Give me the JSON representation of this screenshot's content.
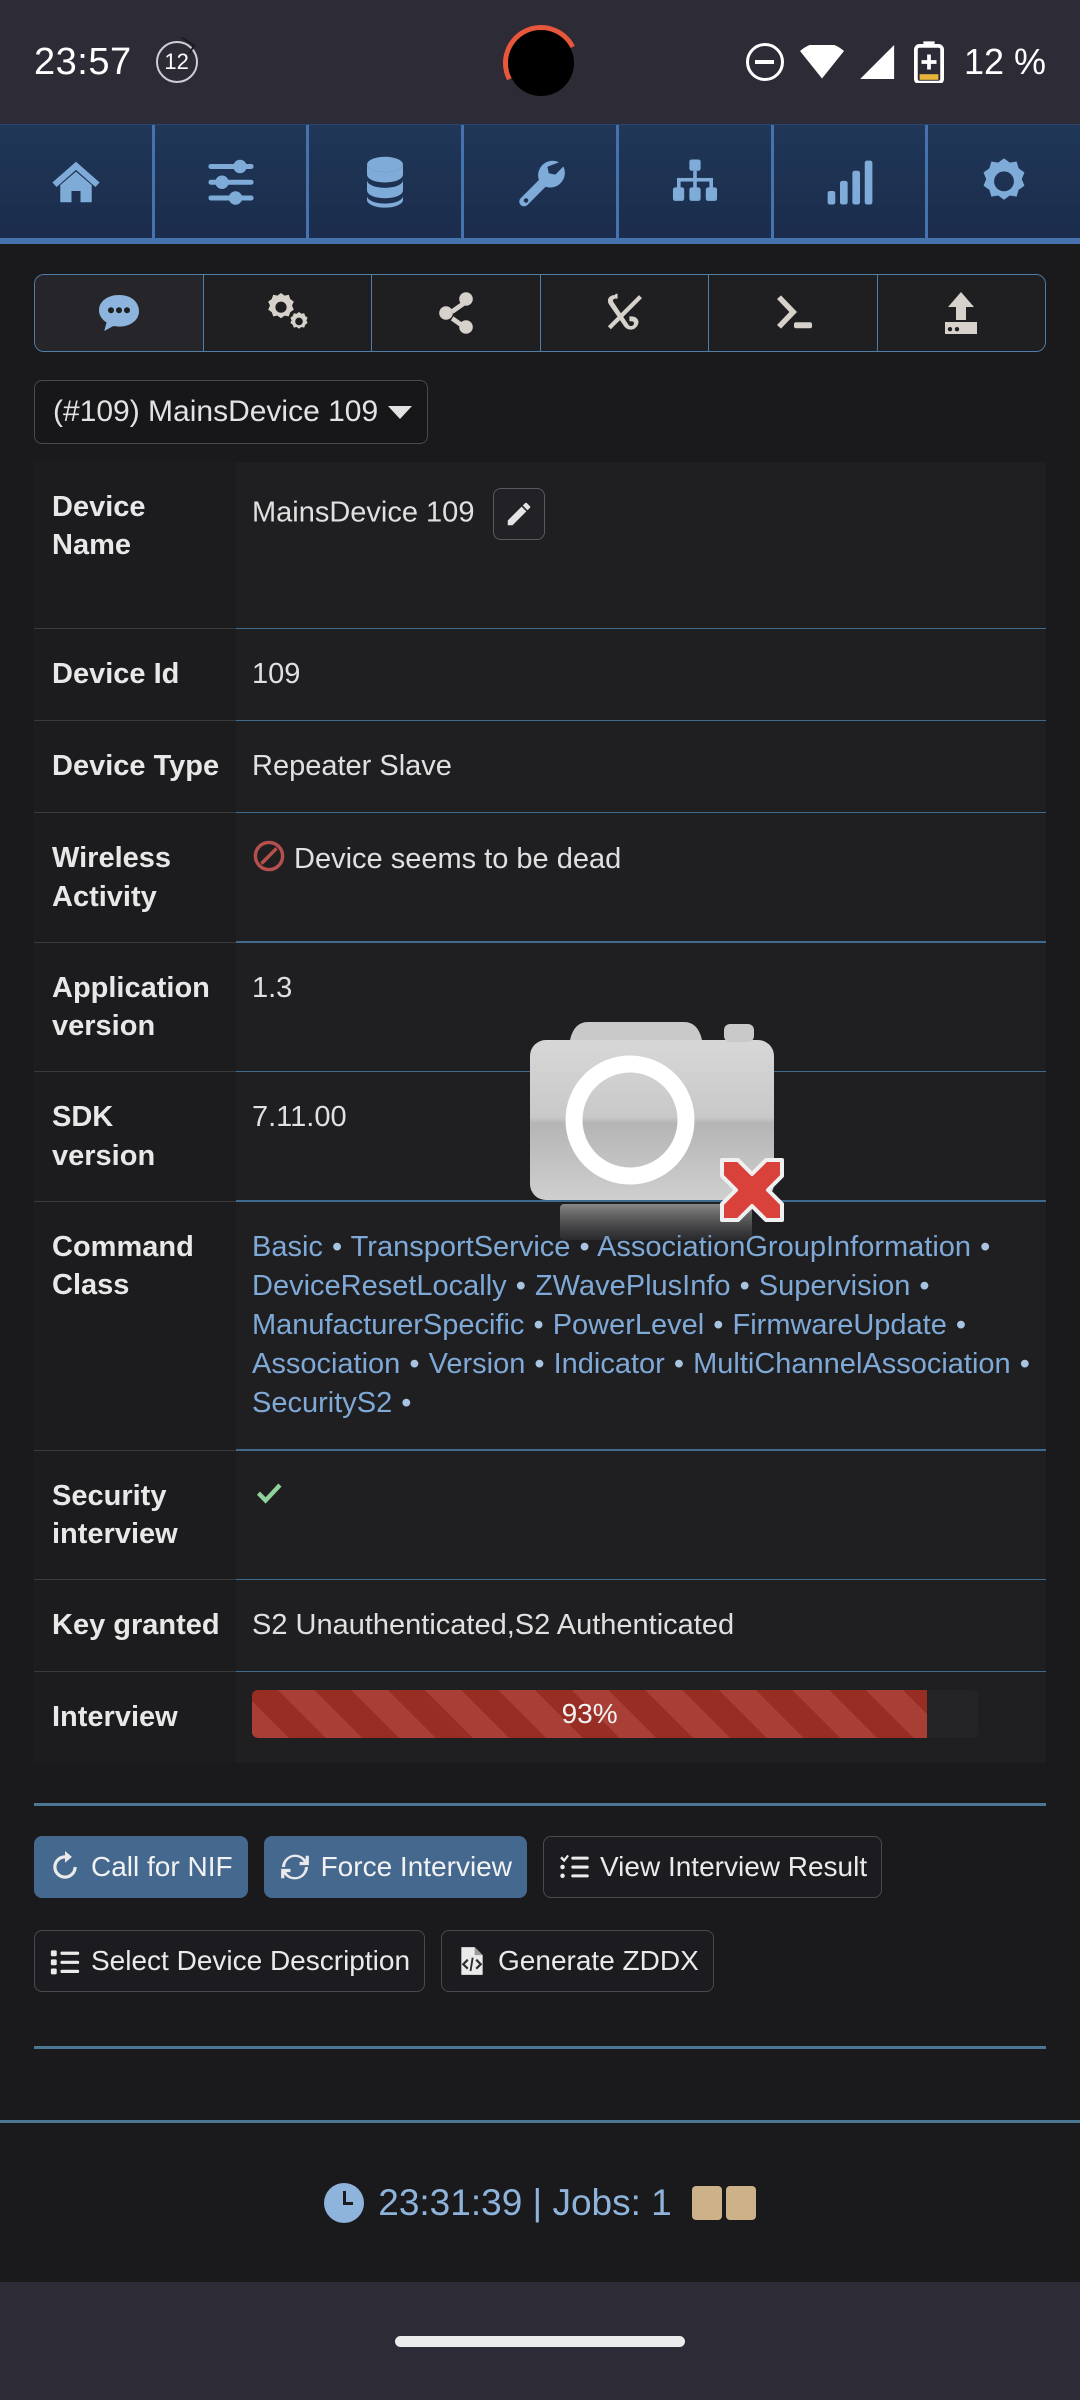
{
  "status_bar": {
    "time": "23:57",
    "notification_count": "12",
    "battery_percent": "12 %",
    "icons": [
      "dnd-icon",
      "wifi-icon",
      "cellular-signal-icon",
      "battery-charging-icon"
    ]
  },
  "nav": {
    "items": [
      {
        "name": "home",
        "icon": "home-icon"
      },
      {
        "name": "preferences",
        "icon": "sliders-icon"
      },
      {
        "name": "database",
        "icon": "database-icon"
      },
      {
        "name": "tools",
        "icon": "wrench-icon"
      },
      {
        "name": "network",
        "icon": "sitemap-icon"
      },
      {
        "name": "statistics",
        "icon": "signal-bars-icon"
      },
      {
        "name": "settings",
        "icon": "gear-icon"
      }
    ]
  },
  "subtoolbar": {
    "items": [
      {
        "name": "comments",
        "icon": "comment-bubble-icon",
        "active": true
      },
      {
        "name": "configuration",
        "icon": "gears-icon",
        "active": false
      },
      {
        "name": "associations",
        "icon": "share-nodes-icon",
        "active": false
      },
      {
        "name": "unlink",
        "icon": "broken-link-icon",
        "active": false
      },
      {
        "name": "expert-commands",
        "icon": "terminal-icon",
        "active": false
      },
      {
        "name": "firmware-upload",
        "icon": "upload-icon",
        "active": false
      }
    ]
  },
  "device_select": {
    "value": "(#109) MainsDevice 109",
    "caret": "chevron-down-icon"
  },
  "details": {
    "rows": [
      {
        "key": "Device Name",
        "value": "MainsDevice 109",
        "has_edit": true
      },
      {
        "key": "Device Id",
        "value": "109"
      },
      {
        "key": "Device Type",
        "value": "Repeater Slave"
      },
      {
        "key": "Wireless Activity",
        "value": "Device seems to be dead",
        "status_icon": "prohibition-icon"
      },
      {
        "key": "Application version",
        "value": "1.3"
      },
      {
        "key": "SDK version",
        "value": "7.11.00"
      },
      {
        "key": "Security interview",
        "value": "",
        "status_icon": "green-check-icon"
      },
      {
        "key": "Key granted",
        "value": "S2 Unauthenticated,S2 Authenticated"
      }
    ],
    "command_class": {
      "key": "Command Class",
      "items": [
        "Basic",
        "TransportService",
        "AssociationGroupInformation",
        "DeviceResetLocally",
        "ZWavePlusInfo",
        "Supervision",
        "ManufacturerSpecific",
        "PowerLevel",
        "FirmwareUpdate",
        "Association",
        "Version",
        "Indicator",
        "MultiChannelAssociation",
        "SecurityS2"
      ]
    },
    "interview": {
      "key": "Interview",
      "percent_label": "93%",
      "percent": 93
    }
  },
  "actions": {
    "row1": [
      {
        "label": "Call for NIF",
        "icon": "refresh-icon",
        "primary": true
      },
      {
        "label": "Force Interview",
        "icon": "sync-icon",
        "primary": true
      },
      {
        "label": "View Interview Result",
        "icon": "list-check-icon",
        "primary": false
      }
    ],
    "row2": [
      {
        "label": "Select Device Description",
        "icon": "list-icon",
        "primary": false
      },
      {
        "label": "Generate ZDDX",
        "icon": "file-code-icon",
        "primary": false
      }
    ]
  },
  "footer": {
    "clock_icon": "clock-icon",
    "text": "23:31:39 | Jobs: 1",
    "chips": 2
  },
  "colors": {
    "nav_bg": "#1d3154",
    "nav_border": "#4672ad",
    "nav_icon": "#7fabd8",
    "accent_blue": "#7fa9d6",
    "primary_button": "#45688f",
    "progress_red": "#a23026",
    "divider": "#4b7795",
    "footer_text": "#8fb4dc",
    "chip": "#cdb289",
    "dead_red": "#b5504c",
    "check_green": "#8ed39a"
  }
}
